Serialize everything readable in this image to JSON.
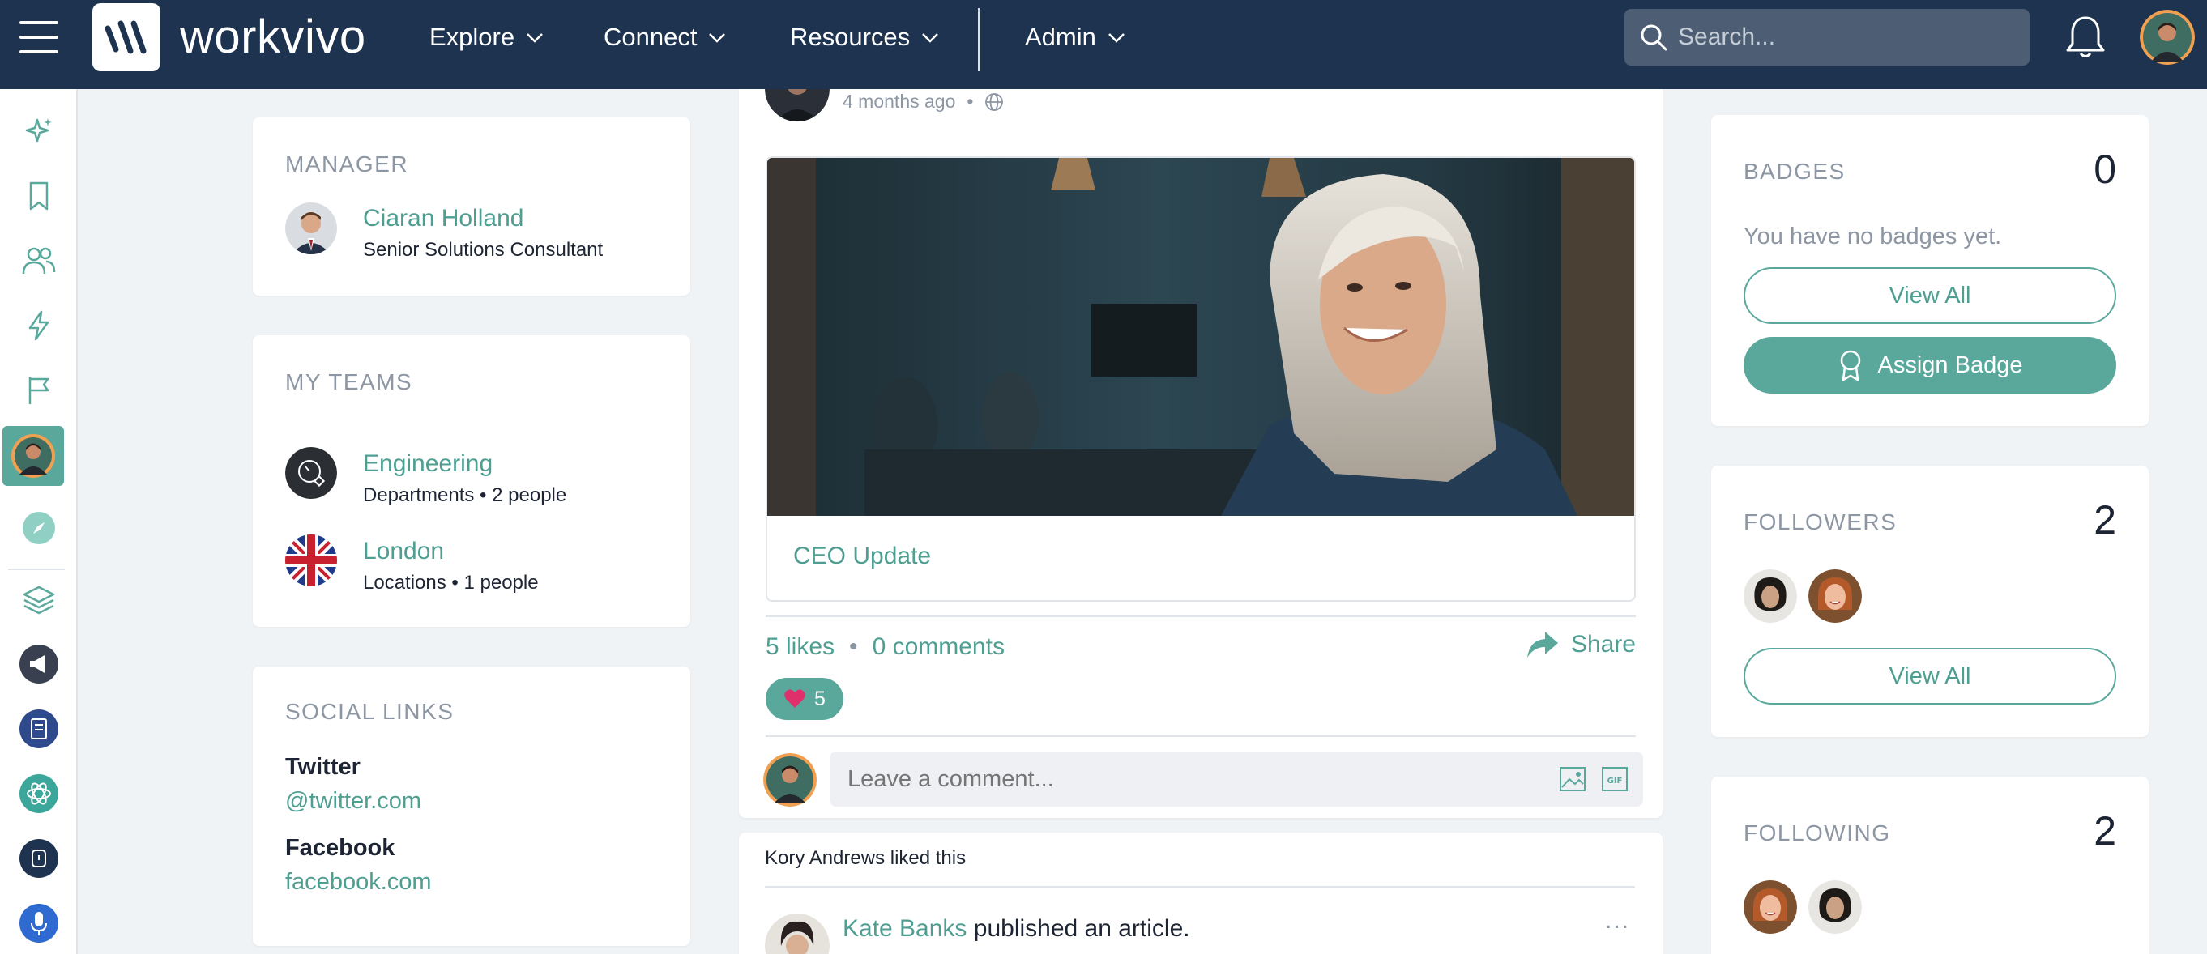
{
  "app": {
    "name": "workvivo"
  },
  "nav": {
    "items": [
      {
        "label": "Explore"
      },
      {
        "label": "Connect"
      },
      {
        "label": "Resources"
      },
      {
        "label": "Admin"
      }
    ],
    "search_placeholder": "Search..."
  },
  "manager": {
    "title": "MANAGER",
    "name": "Ciaran Holland",
    "role": "Senior Solutions Consultant"
  },
  "teams": {
    "title": "MY TEAMS",
    "items": [
      {
        "name": "Engineering",
        "meta": "Departments • 2 people"
      },
      {
        "name": "London",
        "meta": "Locations • 1 people"
      }
    ]
  },
  "social": {
    "title": "SOCIAL LINKS",
    "links": [
      {
        "label": "Twitter",
        "url": "@twitter.com"
      },
      {
        "label": "Facebook",
        "url": "facebook.com"
      }
    ]
  },
  "post": {
    "time": "4 months ago",
    "separator": "•",
    "caption": "CEO Update",
    "likes": "5 likes",
    "comments": "0 comments",
    "share_label": "Share",
    "reaction_count": "5",
    "comment_placeholder": "Leave a comment..."
  },
  "activity": {
    "liked_by": "Kory Andrews liked this",
    "author": "Kate Banks",
    "action": " published an article.",
    "more": "..."
  },
  "badges": {
    "title": "BADGES",
    "count": "0",
    "empty_text": "You have no badges yet.",
    "view_all": "View All",
    "assign": "Assign Badge"
  },
  "followers": {
    "title": "FOLLOWERS",
    "count": "2",
    "view_all": "View All"
  },
  "following": {
    "title": "FOLLOWING",
    "count": "2"
  },
  "colors": {
    "nav_bg": "#1d3350",
    "accent": "#5aa89c",
    "link": "#4e9e92",
    "heart": "#e0306c"
  }
}
